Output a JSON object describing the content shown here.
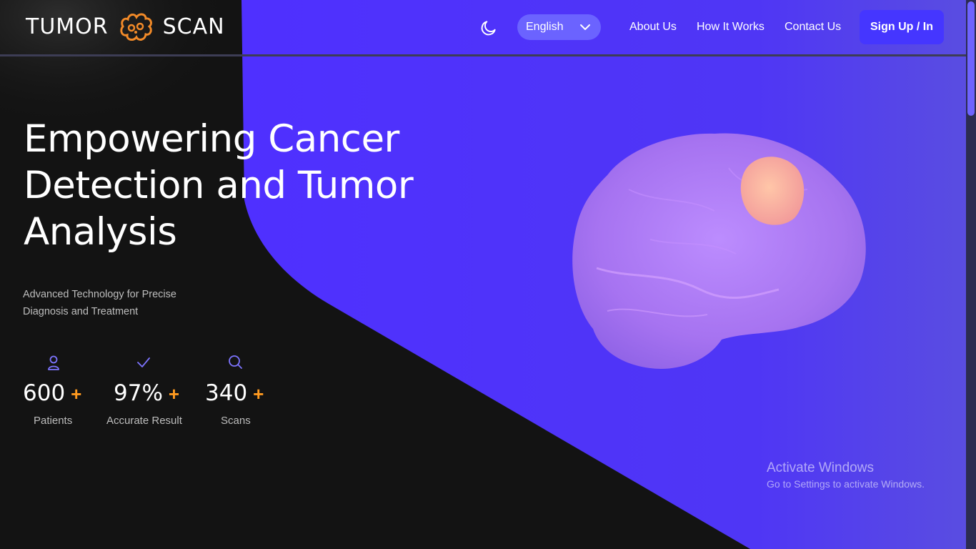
{
  "header": {
    "logo_left": "TUMOR",
    "logo_right": "SCAN",
    "theme_icon": "moon-icon",
    "language": {
      "selected": "English",
      "icon": "chevron-down-icon"
    },
    "nav": [
      {
        "label": "About Us"
      },
      {
        "label": "How It Works"
      },
      {
        "label": "Contact Us"
      }
    ],
    "signup_label": "Sign Up / In"
  },
  "hero": {
    "title": "Empowering Cancer Detection and Tumor Analysis",
    "subtitle": "Advanced Technology for Precise Diagnosis and Treatment",
    "stats": [
      {
        "icon": "user-icon",
        "value": "600",
        "plus": "+",
        "label": "Patients"
      },
      {
        "icon": "check-icon",
        "value": "97%",
        "plus": "+",
        "label": "Accurate Result"
      },
      {
        "icon": "search-icon",
        "value": "340",
        "plus": "+",
        "label": "Scans"
      }
    ],
    "image": "brain-with-tumor-illustration"
  },
  "watermark": {
    "title": "Activate Windows",
    "subtitle": "Go to Settings to activate Windows."
  },
  "colors": {
    "background": "#131313",
    "accent": "#4536ff",
    "accent_light": "#6b63ff",
    "highlight": "#ff9a1f",
    "brain": "#b07af0",
    "tumor": "#ffb19a"
  }
}
